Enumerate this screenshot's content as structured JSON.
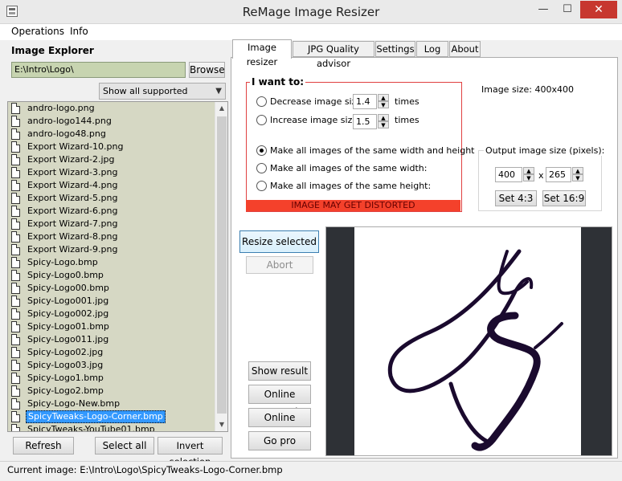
{
  "window": {
    "title": "ReMage Image Resizer",
    "min_glyph": "—",
    "max_glyph": "☐",
    "close_glyph": "✕"
  },
  "menu": {
    "items": [
      "Operations",
      "Info"
    ]
  },
  "explorer": {
    "title": "Image Explorer",
    "path": "E:\\Intro\\Logo\\",
    "browse_label": "Browse",
    "filter_selected": "Show all supported pictures",
    "files": [
      "andro-logo.png",
      "andro-logo144.png",
      "andro-logo48.png",
      "Export Wizard-10.png",
      "Export Wizard-2.jpg",
      "Export Wizard-3.png",
      "Export Wizard-4.png",
      "Export Wizard-5.png",
      "Export Wizard-6.png",
      "Export Wizard-7.png",
      "Export Wizard-8.png",
      "Export Wizard-9.png",
      "Spicy-Logo.bmp",
      "Spicy-Logo0.bmp",
      "Spicy-Logo00.bmp",
      "Spicy-Logo001.jpg",
      "Spicy-Logo002.jpg",
      "Spicy-Logo01.bmp",
      "Spicy-Logo011.jpg",
      "Spicy-Logo02.jpg",
      "Spicy-Logo03.jpg",
      "Spicy-Logo1.bmp",
      "Spicy-Logo2.bmp",
      "Spicy-Logo-New.bmp",
      "SpicyTweaks-Logo-Corner.bmp",
      "SpicyTweaks-YouTube01.bmp"
    ],
    "selected_file": "SpicyTweaks-Logo-Corner.bmp",
    "refresh_label": "Refresh",
    "select_all_label": "Select all",
    "invert_label": "Invert selection"
  },
  "status": {
    "text": "Current image: E:\\Intro\\Logo\\SpicyTweaks-Logo-Corner.bmp"
  },
  "tabs": [
    "Image resizer",
    "JPG Quality advisor",
    "Settings",
    "Log",
    "About"
  ],
  "resizer": {
    "group_title": "I want to:",
    "decrease_label": "Decrease image size",
    "decrease_value": "1.4",
    "increase_label": "Increase image size",
    "increase_value": "1.5",
    "times_label": "times",
    "same_wh_label": "Make all images of the same width and height",
    "same_w_label": "Make all images of the same width:",
    "same_h_label": "Make all images of the same height:",
    "warning": "IMAGE MAY GET DISTORTED",
    "image_size": "Image size: 400x400",
    "output_title": "Output image size (pixels):",
    "width": "400",
    "height": "265",
    "times_sign": "x",
    "set43_label": "Set 4:3",
    "set169_label": "Set 16:9",
    "resize_label": "Resize selected",
    "abort_label": "Abort",
    "show_result_label": "Show result",
    "manual_label": "Online manual",
    "support_label": "Online support",
    "gopro_label": "Go pro"
  },
  "colors": {
    "path_bg": "#c7d4b0",
    "list_bg": "#d6d8c4",
    "selection": "#3399ff",
    "warning": "#f4412b",
    "close": "#c7372f"
  }
}
